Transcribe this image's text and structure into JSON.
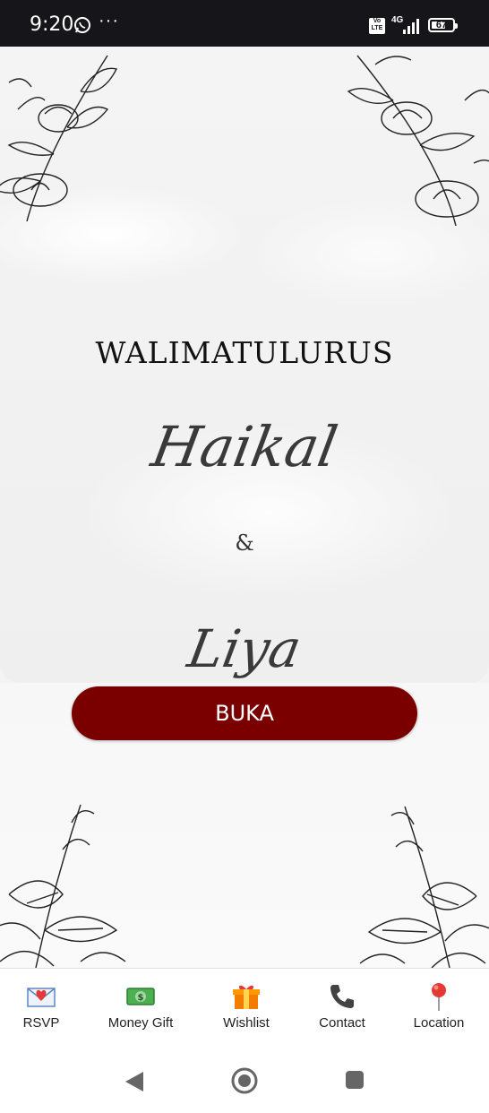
{
  "status_bar": {
    "time": "9:20",
    "more": "···",
    "volte": "Vo LTE",
    "network": "4G",
    "battery": "67",
    "battery_level": 0.67
  },
  "invitation": {
    "heading": "WALIMATULURUS",
    "groom": "Haikal",
    "ampersand": "&",
    "bride": "Liya",
    "open_button": "BUKA",
    "accent_color": "#7a0000"
  },
  "bottom_nav": {
    "items": [
      {
        "label": "RSVP",
        "icon": "love-letter-icon"
      },
      {
        "label": "Money Gift",
        "icon": "money-icon"
      },
      {
        "label": "Wishlist",
        "icon": "gift-icon"
      },
      {
        "label": "Contact",
        "icon": "phone-icon"
      },
      {
        "label": "Location",
        "icon": "pin-icon"
      }
    ]
  },
  "system_nav": {
    "back_icon": "back-triangle-icon",
    "home_icon": "home-circle-icon",
    "recents_icon": "recents-square-icon"
  }
}
